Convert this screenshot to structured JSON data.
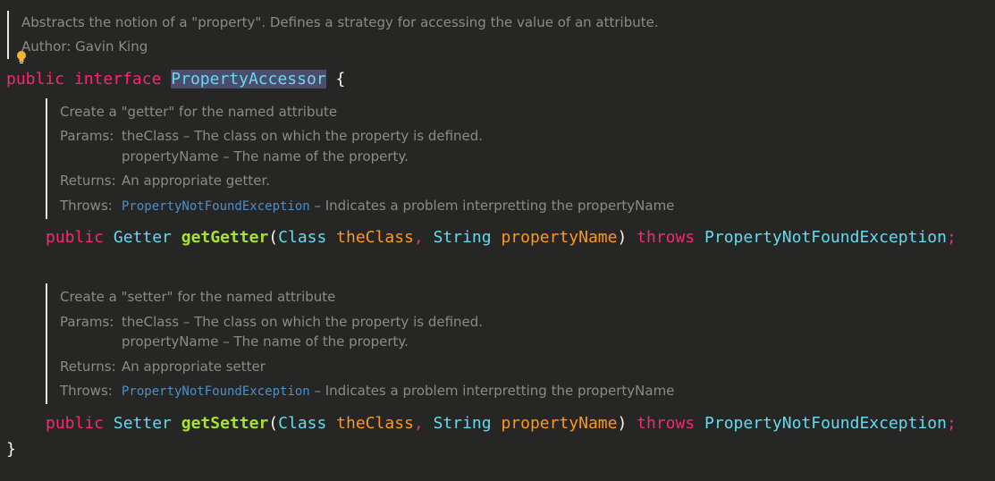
{
  "class_doc": {
    "description": "Abstracts the notion of a \"property\". Defines a strategy for accessing the value of an attribute.",
    "author_label": "Author:",
    "author": "Gavin King"
  },
  "class_decl": {
    "kw_public": "public",
    "kw_interface": "interface",
    "name": "PropertyAccessor",
    "open_brace": "{",
    "close_brace": "}"
  },
  "methods": [
    {
      "doc": {
        "summary": "Create a \"getter\" for the named attribute",
        "params_label": "Params:",
        "param1": "theClass – The class on which the property is defined.",
        "param2": "propertyName – The name of the property.",
        "returns_label": "Returns:",
        "returns": "An appropriate getter.",
        "throws_label": "Throws:",
        "throws_link": "PropertyNotFoundException",
        "throws_desc": " – Indicates a problem interpretting the propertyName"
      },
      "sig": {
        "kw_public": "public",
        "return_type": "Getter",
        "name": "getGetter",
        "open_paren": "(",
        "p1_type": "Class",
        "p1_name": "theClass",
        "comma": ",",
        "p2_type": "String",
        "p2_name": "propertyName",
        "close_paren": ")",
        "kw_throws": "throws",
        "exception": "PropertyNotFoundException",
        "semicolon": ";"
      }
    },
    {
      "doc": {
        "summary": "Create a \"setter\" for the named attribute",
        "params_label": "Params:",
        "param1": "theClass – The class on which the property is defined.",
        "param2": "propertyName – The name of the property.",
        "returns_label": "Returns:",
        "returns": "An appropriate setter",
        "throws_label": "Throws:",
        "throws_link": "PropertyNotFoundException",
        "throws_desc": " – Indicates a problem interpretting the propertyName"
      },
      "sig": {
        "kw_public": "public",
        "return_type": "Setter",
        "name": "getSetter",
        "open_paren": "(",
        "p1_type": "Class",
        "p1_name": "theClass",
        "comma": ",",
        "p2_type": "String",
        "p2_name": "propertyName",
        "close_paren": ")",
        "kw_throws": "throws",
        "exception": "PropertyNotFoundException",
        "semicolon": ";"
      }
    }
  ],
  "colors": {
    "background": "#262624",
    "keyword": "#f92672",
    "type": "#66d9ef",
    "method": "#a6e22e",
    "param": "#fd971f",
    "doc_text": "#8b8b86",
    "doc_link": "#4e8ec9"
  },
  "icons": {
    "intention": "lightbulb-icon"
  }
}
